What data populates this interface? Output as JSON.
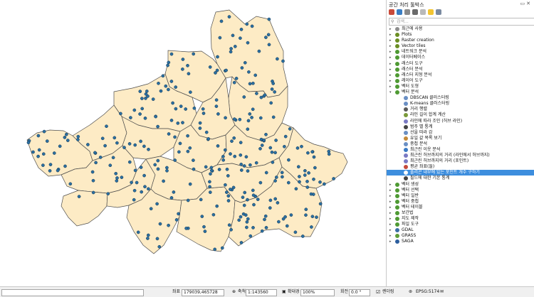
{
  "map": {
    "fill": "#fdebc5",
    "stroke": "#4e4e4e",
    "point_color": "#2b6fa1",
    "point_stroke": "#16354d"
  },
  "toolbox": {
    "title": "공간 처리 툴박스",
    "search_placeholder": "검색...",
    "items": [
      {
        "label": "최근에 사용",
        "expand": "▸",
        "icon": "gear-icon",
        "color": "#8d8d8d"
      },
      {
        "label": "Plots",
        "expand": "▸",
        "icon": "plugin-icon",
        "color": "#6b8e23"
      },
      {
        "label": "Raster creation",
        "expand": "▸",
        "icon": "plugin-icon",
        "color": "#6b8e23"
      },
      {
        "label": "Vector tiles",
        "expand": "▸",
        "icon": "plugin-icon",
        "color": "#6b8e23"
      },
      {
        "label": "네트워크 분석",
        "expand": "▸",
        "icon": "qgis-icon",
        "color": "#4f9a33"
      },
      {
        "label": "데이터베이스",
        "expand": "▸",
        "icon": "qgis-icon",
        "color": "#4f9a33"
      },
      {
        "label": "래스터 도구",
        "expand": "▸",
        "icon": "qgis-icon",
        "color": "#4f9a33"
      },
      {
        "label": "래스터 분석",
        "expand": "▸",
        "icon": "qgis-icon",
        "color": "#4f9a33"
      },
      {
        "label": "래스터 지형 분석",
        "expand": "▸",
        "icon": "qgis-icon",
        "color": "#4f9a33"
      },
      {
        "label": "레이어 도구",
        "expand": "▸",
        "icon": "qgis-icon",
        "color": "#4f9a33"
      },
      {
        "label": "벡터 도형",
        "expand": "▸",
        "icon": "qgis-icon",
        "color": "#4f9a33"
      },
      {
        "label": "벡터 분석",
        "expand": "▾",
        "icon": "qgis-icon",
        "color": "#4f9a33"
      },
      {
        "label": "DBSCAN 클러스터링",
        "expand": "",
        "icon": "gear-icon",
        "color": "#6a8fc4",
        "child": true
      },
      {
        "label": "K-means 클러스터링",
        "expand": "",
        "icon": "gear-icon",
        "color": "#6a8fc4",
        "child": true
      },
      {
        "label": "거리 행렬",
        "expand": "",
        "icon": "matrix-icon",
        "color": "#5a5a5a",
        "child": true
      },
      {
        "label": "라인 길이 합계 계산",
        "expand": "",
        "icon": "line-icon",
        "color": "#7a9a3a",
        "child": true
      },
      {
        "label": "라인에 따라 조인 (허브 라인)",
        "expand": "",
        "icon": "hub-icon",
        "color": "#7a7ac4",
        "child": true
      },
      {
        "label": "범주 별 통계",
        "expand": "",
        "icon": "sigma-icon",
        "color": "#444444",
        "child": true
      },
      {
        "label": "선을 따라 감",
        "expand": "",
        "icon": "gear-icon",
        "color": "#6a8fc4",
        "child": true
      },
      {
        "label": "유일 값 목록 보기",
        "expand": "",
        "icon": "list-icon",
        "color": "#c48a3a",
        "child": true
      },
      {
        "label": "중첩 분석",
        "expand": "",
        "icon": "gear-icon",
        "color": "#6a8fc4",
        "child": true
      },
      {
        "label": "최근린 이웃 분석",
        "expand": "",
        "icon": "neighbor-icon",
        "color": "#3a7ac4",
        "child": true
      },
      {
        "label": "최근린 허브까지의 거리 (라인에서 허브까지)",
        "expand": "",
        "icon": "hub-icon",
        "color": "#7a7ac4",
        "child": true
      },
      {
        "label": "최근린 허브까지의 거리 (포인트)",
        "expand": "",
        "icon": "hub-icon",
        "color": "#7a7ac4",
        "child": true
      },
      {
        "label": "평균 좌표(들)",
        "expand": "",
        "icon": "mean-icon",
        "color": "#c44a3a",
        "child": true
      },
      {
        "label": "폴리곤 내부에 있는 포인트 개수 구하기",
        "expand": "",
        "icon": "count-icon",
        "color": "#ffffff",
        "child": true,
        "selected": true
      },
      {
        "label": "필드에 대한 기본 통계",
        "expand": "",
        "icon": "sigma-icon",
        "color": "#444444",
        "child": true
      },
      {
        "label": "벡터 생성",
        "expand": "▸",
        "icon": "qgis-icon",
        "color": "#4f9a33"
      },
      {
        "label": "벡터 선택",
        "expand": "▸",
        "icon": "qgis-icon",
        "color": "#4f9a33"
      },
      {
        "label": "벡터 일반",
        "expand": "▸",
        "icon": "qgis-icon",
        "color": "#4f9a33"
      },
      {
        "label": "벡터 중첩",
        "expand": "▸",
        "icon": "qgis-icon",
        "color": "#4f9a33"
      },
      {
        "label": "벡터 테이블",
        "expand": "▸",
        "icon": "qgis-icon",
        "color": "#4f9a33"
      },
      {
        "label": "보간법",
        "expand": "▸",
        "icon": "qgis-icon",
        "color": "#4f9a33"
      },
      {
        "label": "지도 제작",
        "expand": "▸",
        "icon": "qgis-icon",
        "color": "#4f9a33"
      },
      {
        "label": "파일 도구",
        "expand": "▸",
        "icon": "qgis-icon",
        "color": "#4f9a33"
      },
      {
        "label": "GDAL",
        "expand": "▸",
        "icon": "gdal-icon",
        "color": "#3a6ea5"
      },
      {
        "label": "GRASS",
        "expand": "▸",
        "icon": "grass-icon",
        "color": "#5f9e3a"
      },
      {
        "label": "SAGA",
        "expand": "▸",
        "icon": "saga-icon",
        "color": "#2c5e9e"
      }
    ]
  },
  "status": {
    "coord_label": "좌표",
    "coord_value": "179039,465728",
    "scale_label": "축척",
    "scale_value": "1:143560",
    "magnifier_label": "확대경",
    "magnifier_value": "100%",
    "rotation_label": "회전",
    "rotation_value": "0.0 °",
    "render_label": "렌더링",
    "crs_label": "EPSG:5174"
  }
}
